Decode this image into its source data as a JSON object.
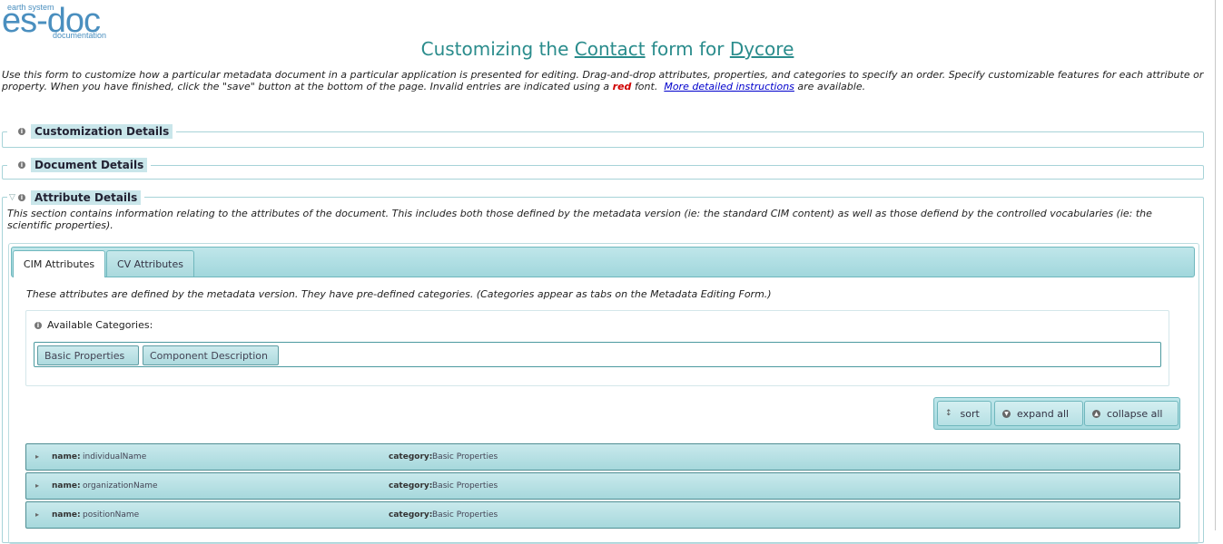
{
  "logo": {
    "tagline_top": "earth system",
    "wordmark": "es-doc",
    "tagline_bottom": "documentation"
  },
  "title": {
    "prefix": "Customizing the",
    "link1": "Contact",
    "middle": "form for",
    "link2": "Dycore"
  },
  "intro": {
    "part1": "Use this form to customize how a particular metadata document in a particular application is presented for editing.   Drag-and-drop attributes, properties, and categories to specify an order.   Specify customizable features for each attribute or property.   When you have finished, click the \"save\" button at the bottom of the page.   Invalid entries are indicated using a",
    "red_word": "red",
    "part2": "font.",
    "link": "More detailed instructions",
    "part3": "are available."
  },
  "sections": {
    "customization": "Customization Details",
    "document": "Document Details",
    "attribute": "Attribute Details"
  },
  "attribute_desc": "This section contains information relating to the attributes of the document. This includes both those defined by the metadata version (ie: the standard CIM content) as well as those defiend by the controlled vocabularies (ie: the scientific properties).",
  "tabs": [
    {
      "label": "CIM Attributes"
    },
    {
      "label": "CV Attributes"
    }
  ],
  "cim_desc": "These attributes are defined by the metadata version. They have pre-defined categories. (Categories appear as tabs on the Metadata Editing Form.)",
  "categories": {
    "label": "Available Categories:",
    "items": [
      "Basic Properties",
      "Component Description"
    ]
  },
  "buttons": {
    "sort": "sort",
    "expand": "expand all",
    "collapse": "collapse all"
  },
  "row_labels": {
    "name": "name:",
    "category": "category:"
  },
  "rows": [
    {
      "name": "individualName",
      "category": "Basic Properties"
    },
    {
      "name": "organizationName",
      "category": "Basic Properties"
    },
    {
      "name": "positionName",
      "category": "Basic Properties"
    }
  ]
}
